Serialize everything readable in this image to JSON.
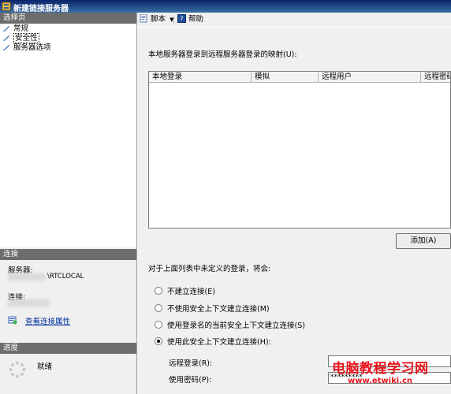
{
  "window": {
    "title": "新建链接服务器"
  },
  "sidebar": {
    "pages_header": "选择页",
    "pages": [
      {
        "label": "常规"
      },
      {
        "label": "安全性"
      },
      {
        "label": "服务器选项"
      }
    ],
    "connection": {
      "header": "连接",
      "server_label": "服务器:",
      "server_value": "\\RTCLOCAL",
      "conn_label": "连接:",
      "view_props_link": "查看连接属性"
    },
    "progress": {
      "header": "进度",
      "status": "就绪"
    }
  },
  "toolbar": {
    "script_label": "脚本",
    "help_label": "帮助"
  },
  "main": {
    "mapping_caption": "本地服务器登录到远程服务器登录的映射(U):",
    "grid_headers": [
      "本地登录",
      "模拟",
      "远程用户",
      "远程密码"
    ],
    "add_button": "添加(A)",
    "undefined_caption": "对于上面列表中未定义的登录，将会:",
    "options": [
      {
        "label": "不建立连接(E)",
        "selected": false
      },
      {
        "label": "不使用安全上下文建立连接(M)",
        "selected": false
      },
      {
        "label": "使用登录名的当前安全上下文建立连接(S)",
        "selected": false
      },
      {
        "label": "使用此安全上下文建立连接(H):",
        "selected": true
      }
    ],
    "remote_login_label": "远程登录(R):",
    "password_label": "使用密码(P):",
    "password_value": "*********"
  },
  "watermark": {
    "title": "电脑教程学习网",
    "url": "www.etwiki.cn"
  }
}
